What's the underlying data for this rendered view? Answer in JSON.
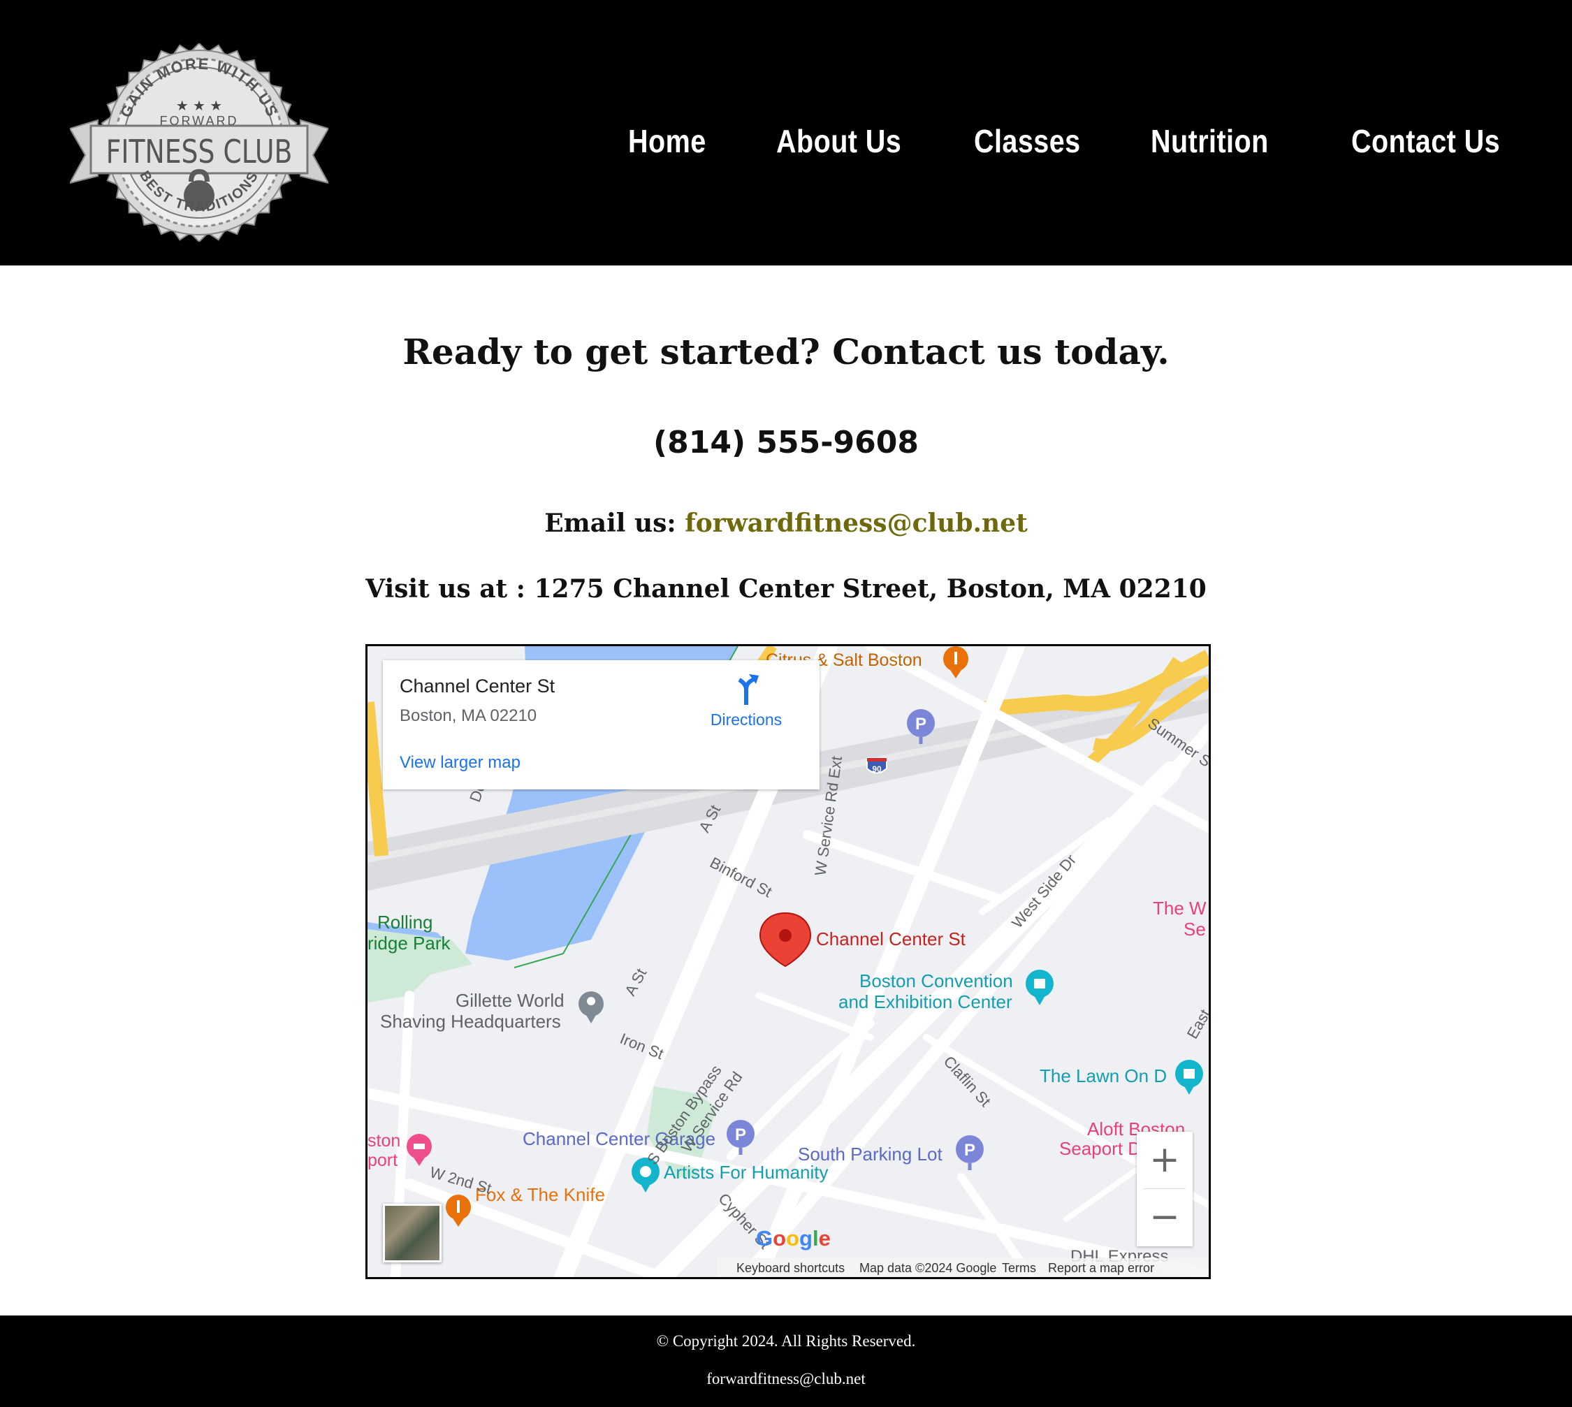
{
  "header": {
    "logo": {
      "top_arc": "GAIN MORE WITH US",
      "sub": "FORWARD",
      "main": "FITNESS CLUB",
      "bottom_arc": "BEST TRADITIONS"
    },
    "nav": [
      "Home",
      "About Us",
      "Classes",
      "Nutrition",
      "Contact Us"
    ]
  },
  "main": {
    "title": "Ready to get started? Contact us today.",
    "phone": "(814) 555-9608",
    "email_label": "Email us: ",
    "email": "forwardfitness@club.net",
    "address": "Visit us at : 1275 Channel Center Street, Boston, MA 02210"
  },
  "map": {
    "card_title": "Channel Center St",
    "card_subtitle": "Boston, MA 02210",
    "card_link": "View larger map",
    "directions": "Directions",
    "pin_label": "Channel Center St",
    "labels": {
      "citrus": "Citrus & Salt Boston",
      "rolling1": "Rolling",
      "rolling2": "ridge Park",
      "gillette1": "Gillette World",
      "gillette2": "Shaving Headquarters",
      "boston_conv1": "Boston Convention",
      "boston_conv2": "and Exhibition Center",
      "lawn": "The Lawn On D",
      "aloft1": "Aloft Boston",
      "aloft2": "Seaport D",
      "garage": "Channel Center Garage",
      "artists": "Artists For Humanity",
      "south_lot": "South Parking Lot",
      "fox": "Fox & The Knife",
      "westin1": "The W",
      "westin2": "Se",
      "ston1": "ston",
      "ston2": "port",
      "dhl": "DHL Express",
      "i90": "90",
      "a_st_1": "A St",
      "a_st_2": "A St",
      "binford": "Binford St",
      "w_service": "W Service Rd Ext",
      "west_side": "West Side Dr",
      "iron": "Iron St",
      "bypass": "S Boston Bypass",
      "w_service2": "W Service Rd",
      "claflin": "Claflin St",
      "w2nd": "W 2nd St",
      "cypher": "Cypher St",
      "summer": "Summer S",
      "east": "East",
      "dot": "Do"
    },
    "zoom_in": "+",
    "zoom_out": "−",
    "google": "Google",
    "attribution": {
      "shortcuts": "Keyboard shortcuts",
      "data": "Map data ©2024 Google",
      "terms": "Terms",
      "report": "Report a map error"
    }
  },
  "footer": {
    "copyright": "© Copyright 2024. All Rights Reserved.",
    "email": "forwardfitness@club.net"
  },
  "colors": {
    "header_bg": "#000000",
    "email_link": "#6e6a0b",
    "map_pin": "#ea4335",
    "map_link": "#1a73e8",
    "water": "#9cc0f9",
    "highway": "#f7cb4d"
  }
}
